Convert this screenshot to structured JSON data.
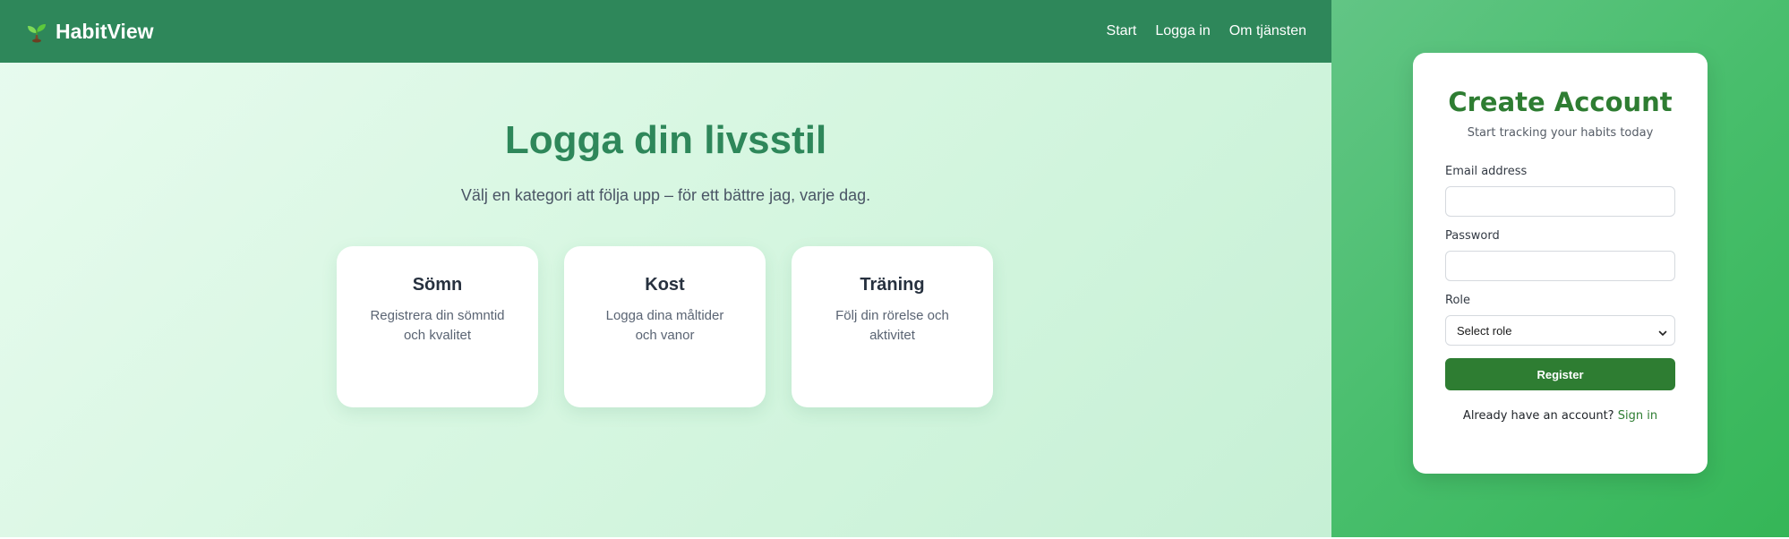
{
  "app": {
    "brand_name": "HabitView",
    "brand_icon": "seedling-icon",
    "colors": {
      "nav_bg": "#2e875a",
      "accent_green": "#2e7d32",
      "hero_title": "#2e875a"
    }
  },
  "nav": {
    "links": [
      {
        "label": "Start"
      },
      {
        "label": "Logga in"
      },
      {
        "label": "Om tjänsten"
      }
    ]
  },
  "hero": {
    "title": "Logga din livsstil",
    "subtitle": "Välj en kategori att följa upp – för ett bättre jag, varje dag."
  },
  "categories": [
    {
      "title": "Sömn",
      "description": "Registrera din sömntid och kvalitet"
    },
    {
      "title": "Kost",
      "description": "Logga dina måltider och vanor"
    },
    {
      "title": "Träning",
      "description": "Följ din rörelse och aktivitet"
    }
  ],
  "register_form": {
    "title": "Create Account",
    "subtitle": "Start tracking your habits today",
    "email_label": "Email address",
    "email_value": "",
    "password_label": "Password",
    "password_value": "",
    "role_label": "Role",
    "role_selected": "Select role",
    "submit_label": "Register",
    "signin_prompt": "Already have an account?",
    "signin_link": "Sign in"
  }
}
